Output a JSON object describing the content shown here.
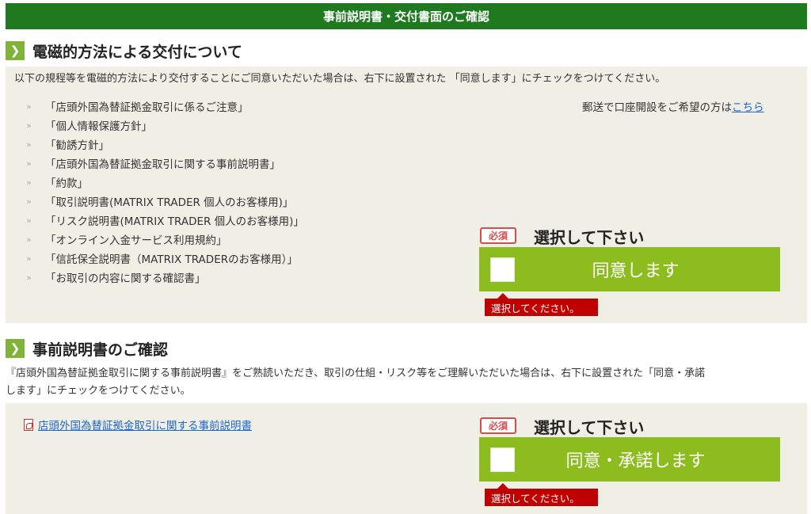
{
  "header": {
    "title": "事前説明書・交付書面のご確認"
  },
  "section1": {
    "chevron": "❯",
    "title": "電磁的方法による交付について",
    "description": "以下の規程等を電磁的方法により交付することにご同意いただいた場合は、右下に設置された 「同意します」にチェックをつけてください。",
    "documents": [
      "「店頭外国為替証拠金取引に係るご注意」",
      "「個人情報保護方針」",
      "「勧誘方針」",
      "「店頭外国為替証拠金取引に関する事前説明書」",
      "「約款」",
      "「取引説明書(MATRIX TRADER 個人のお客様用)」",
      "「リスク説明書(MATRIX TRADER 個人のお客様用)」",
      "「オンライン入金サービス利用規約」",
      "「信託保全説明書（MATRIX TRADERのお客様用）」",
      "「お取引の内容に関する確認書」"
    ],
    "bullet": "»",
    "mail_note_prefix": "郵送で口座開設をご希望の方は",
    "mail_note_link": "こちら",
    "required_badge": "必須",
    "select_label": "選択して下さい",
    "agree_label": "同意します",
    "error_message": "選択してください。"
  },
  "section2": {
    "chevron": "❯",
    "title": "事前説明書のご確認",
    "description_line1": "『店頭外国為替証拠金取引に関する事前説明書』をご熟読いただき、取引の仕組・リスク等をご理解いただいた場合は、右下に設置された「同意・承諾",
    "description_line2": "します」にチェックをつけてください。",
    "pdf_link": "店頭外国為替証拠金取引に関する事前説明書",
    "required_badge": "必須",
    "select_label": "選択して下さい",
    "agree_label": "同意・承諾します",
    "error_message": "選択してください。"
  },
  "colors": {
    "header_green": "#1f7a1f",
    "chevron_green": "#7fb33a",
    "agree_green": "#8cbc1e",
    "panel_bg": "#efefe6",
    "error_red": "#c00000",
    "link_blue": "#2266cc"
  }
}
